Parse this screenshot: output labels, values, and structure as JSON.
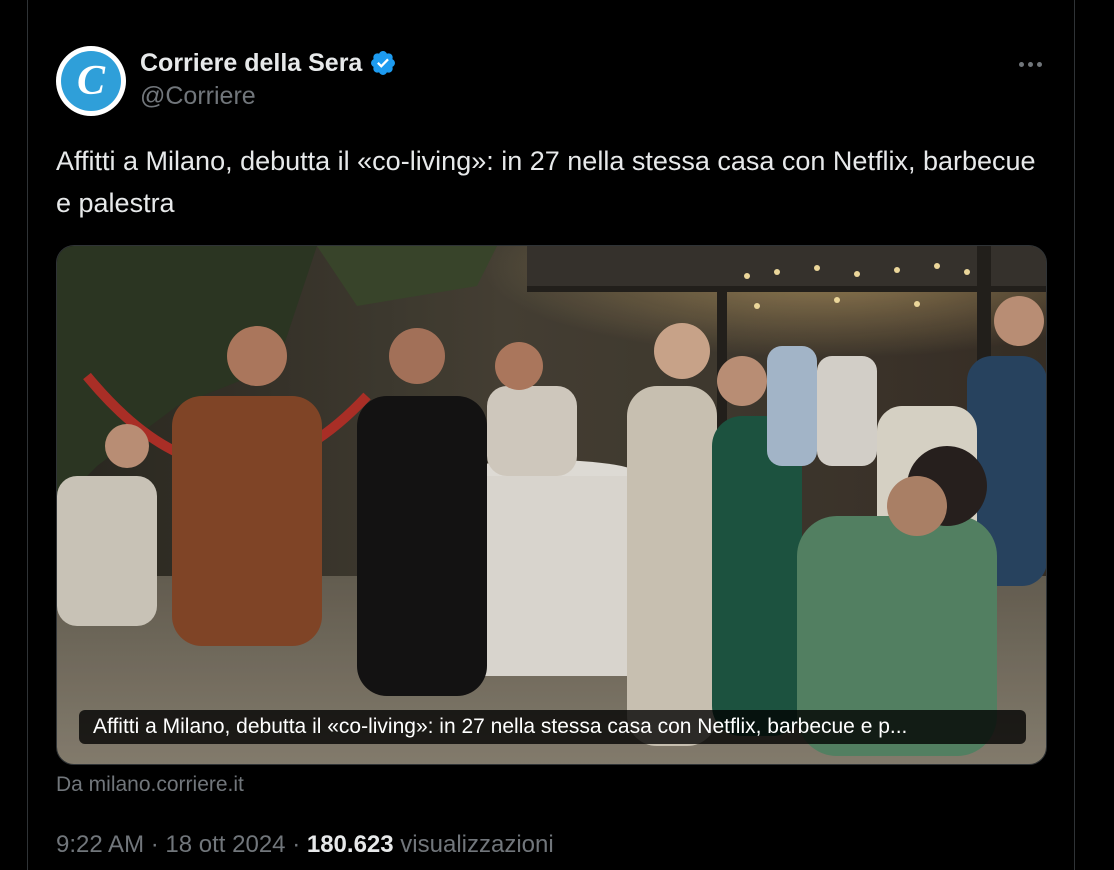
{
  "tweet": {
    "author": {
      "display_name": "Corriere della Sera",
      "handle": "@Corriere",
      "verified": true,
      "avatar_letter": "C",
      "avatar_color": "#2f9fd9",
      "verified_color": "#1d9bf0"
    },
    "more_icon": "more-horizontal-icon",
    "text": "Affitti a Milano, debutta il «co-living»: in 27 nella stessa casa con Netflix, barbecue e palestra",
    "card": {
      "caption": "Affitti a Milano, debutta il «co-living»: in 27 nella stessa casa con Netflix, barbecue e p...",
      "source": "Da milano.corriere.it"
    },
    "meta": {
      "time": "9:22 AM",
      "separator": "·",
      "date": "18 ott 2024",
      "views_count": "180.623",
      "views_label": "visualizzazioni"
    }
  },
  "colors": {
    "background": "#000000",
    "text_primary": "#e7e9ea",
    "text_secondary": "#71767b",
    "border": "#2f3336"
  }
}
